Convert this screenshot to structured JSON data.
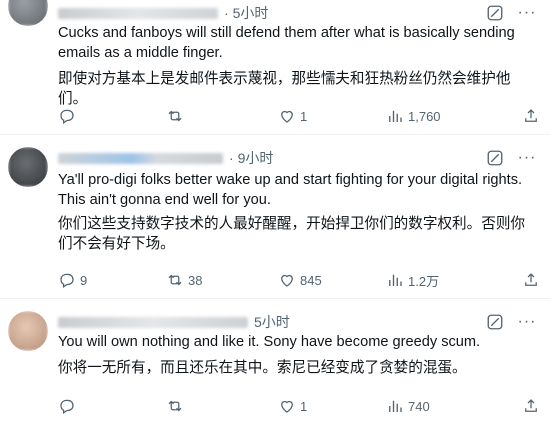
{
  "posts": [
    {
      "time": "5小时",
      "text_en": "Cucks and fanboys will still defend them after what is basically sending emails as a middle finger.",
      "text_zh": "即使对方基本上是发邮件表示蔑视，那些懦夫和狂热粉丝仍然会维护他们。",
      "replies": "",
      "reposts": "",
      "likes": "1",
      "views": "1,760"
    },
    {
      "time": "9小时",
      "text_en": "Ya'll pro-digi folks better wake up and start fighting for your digital rights. This ain't gonna end well for you.",
      "text_zh": "你们这些支持数字技术的人最好醒醒，开始捍卫你们的数字权利。否则你们不会有好下场。",
      "replies": "9",
      "reposts": "38",
      "likes": "845",
      "views": "1.2万"
    },
    {
      "time": "5小时",
      "text_en": "You will own nothing and like it. Sony have become greedy scum.",
      "text_zh": "你将一无所有，而且还乐在其中。索尼已经变成了贪婪的混蛋。",
      "replies": "",
      "reposts": "",
      "likes": "1",
      "views": "740"
    }
  ],
  "icons": {
    "grok": "grok-icon",
    "more": "more-icon",
    "reply": "reply-icon",
    "repost": "repost-icon",
    "like": "like-icon",
    "views": "views-icon"
  },
  "colors": {
    "text": "#0f1419",
    "secondary": "#536471",
    "divider": "#eff3f4"
  }
}
